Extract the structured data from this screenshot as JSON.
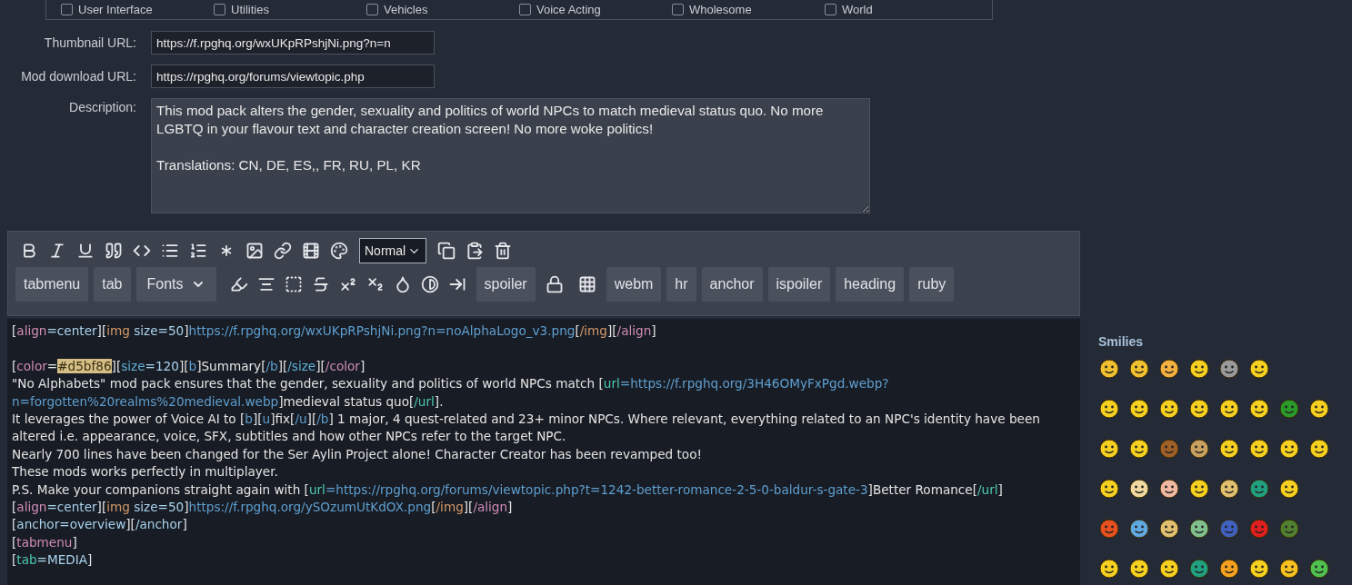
{
  "categories": [
    {
      "label": "User Interface",
      "checked": false
    },
    {
      "label": "Utilities",
      "checked": false
    },
    {
      "label": "Vehicles",
      "checked": false
    },
    {
      "label": "Voice Acting",
      "checked": false
    },
    {
      "label": "Wholesome",
      "checked": false
    },
    {
      "label": "World",
      "checked": false
    }
  ],
  "fields": [
    {
      "label": "Thumbnail URL:",
      "value": "https://f.rpghq.org/wxUKpRPshjNi.png?n=n"
    },
    {
      "label": "Mod download URL:",
      "value": "https://rpghq.org/forums/viewtopic.php"
    }
  ],
  "description": {
    "label": "Description:",
    "value": "This mod pack alters the gender, sexuality and politics of world NPCs to match medieval status quo. No more LGBTQ in your flavour text and character creation screen! No more woke politics!\n\nTranslations: CN, DE, ES,, FR, RU, PL, KR"
  },
  "toolbar": {
    "format_select": "Normal",
    "buttons": [
      {
        "kind": "button",
        "label": "tabmenu"
      },
      {
        "kind": "button",
        "label": "tab"
      },
      {
        "kind": "dropdown",
        "label": "Fonts"
      },
      {
        "kind": "button",
        "label": "spoiler"
      },
      {
        "kind": "button",
        "label": "webm"
      },
      {
        "kind": "button",
        "label": "hr"
      },
      {
        "kind": "button",
        "label": "anchor"
      },
      {
        "kind": "button",
        "label": "ispoiler"
      },
      {
        "kind": "button",
        "label": "heading"
      },
      {
        "kind": "button",
        "label": "ruby"
      }
    ]
  },
  "editor": {
    "lines": [
      [
        {
          "text": "["
        },
        {
          "text": "align",
          "color": "#d18cb8"
        },
        {
          "text": "=center",
          "color": "#a9d2ee"
        },
        {
          "text": "]["
        },
        {
          "text": "img",
          "color": "#d49a6a"
        },
        {
          "text": " size=50",
          "color": "#a9d2ee"
        },
        {
          "text": "]"
        },
        {
          "text": "https://f.rpghq.org/wxUKpRPshjNi.png?n=noAlphaLogo_v3.png",
          "color": "#5f9fd0"
        },
        {
          "text": "["
        },
        {
          "text": "/img",
          "color": "#d49a6a"
        },
        {
          "text": "]["
        },
        {
          "text": "/align",
          "color": "#d18cb8"
        },
        {
          "text": "]"
        }
      ],
      [
        {
          "kind": "blank"
        }
      ],
      [
        {
          "text": "["
        },
        {
          "text": "color",
          "color": "#d18cb8"
        },
        {
          "text": "="
        },
        {
          "text": "#d5bf86",
          "kind": "highlight"
        },
        {
          "text": "]["
        },
        {
          "text": "size",
          "color": "#5fb0d8"
        },
        {
          "text": "=120",
          "color": "#a9d2ee"
        },
        {
          "text": "]["
        },
        {
          "text": "b",
          "color": "#5f9fd0"
        },
        {
          "text": "]Summary["
        },
        {
          "text": "/b",
          "color": "#5f9fd0"
        },
        {
          "text": "]["
        },
        {
          "text": "/size",
          "color": "#5fb0d8"
        },
        {
          "text": "]["
        },
        {
          "text": "/color",
          "color": "#d18cb8"
        },
        {
          "text": "]"
        }
      ],
      [
        {
          "text": "\"No Alphabets\" mod pack ensures that the gender, sexuality and politics of world NPCs match ["
        },
        {
          "text": "url",
          "color": "#4ec9b0"
        },
        {
          "text": "=https://f.rpghq.org/3H46OMyFxPgd.webp?n=forgotten%20realms%20medieval.webp",
          "color": "#5f9fd0"
        },
        {
          "text": "]medieval status quo["
        },
        {
          "text": "/url",
          "color": "#4ec9b0"
        },
        {
          "text": "]."
        }
      ],
      [
        {
          "text": " It leverages the power of Voice AI to ["
        },
        {
          "text": "b",
          "color": "#5f9fd0"
        },
        {
          "text": "]["
        },
        {
          "text": "u",
          "color": "#5f9fd0"
        },
        {
          "text": "]fix["
        },
        {
          "text": "/u",
          "color": "#5f9fd0"
        },
        {
          "text": "]["
        },
        {
          "text": "/b",
          "color": "#5f9fd0"
        },
        {
          "text": "] 1 major, 4 quest-related and 23+ minor NPCs. Where relevant, everything related to an NPC's identity have been altered i.e. appearance, voice, SFX, subtitles and how other NPCs refer to the target NPC."
        }
      ],
      [
        {
          "text": "Nearly 700 lines have been changed for the Ser Aylin Project alone! Character Creator has been revamped too!"
        }
      ],
      [
        {
          "text": "These mods works perfectly in multiplayer."
        }
      ],
      [
        {
          "text": "P.S. Make your companions straight again with ["
        },
        {
          "text": "url",
          "color": "#4ec9b0"
        },
        {
          "text": "=https://rpghq.org/forums/viewtopic.php?t=1242-better-romance-2-5-0-baldur-s-gate-3",
          "color": "#5f9fd0"
        },
        {
          "text": "]Better Romance["
        },
        {
          "text": "/url",
          "color": "#4ec9b0"
        },
        {
          "text": "]"
        }
      ],
      [
        {
          "text": "["
        },
        {
          "text": "align",
          "color": "#d18cb8"
        },
        {
          "text": "=center",
          "color": "#a9d2ee"
        },
        {
          "text": "]["
        },
        {
          "text": "img",
          "color": "#d49a6a"
        },
        {
          "text": " size=50",
          "color": "#a9d2ee"
        },
        {
          "text": "]"
        },
        {
          "text": "https://f.rpghq.org/ySOzumUtKdOX.png",
          "color": "#5f9fd0"
        },
        {
          "text": "["
        },
        {
          "text": "/img",
          "color": "#d49a6a"
        },
        {
          "text": "]["
        },
        {
          "text": "/align",
          "color": "#d18cb8"
        },
        {
          "text": "]"
        }
      ],
      [
        {
          "text": "["
        },
        {
          "text": "anchor=overview",
          "color": "#a9d2ee"
        },
        {
          "text": "]["
        },
        {
          "text": "/anchor",
          "color": "#a9d2ee"
        },
        {
          "text": "]"
        }
      ],
      [
        {
          "text": "["
        },
        {
          "text": "tabmenu",
          "color": "#d18cb8"
        },
        {
          "text": "]"
        }
      ],
      [
        {
          "text": "["
        },
        {
          "text": "tab",
          "color": "#4ec9b0"
        },
        {
          "text": "=MEDIA",
          "color": "#a9d2ee"
        },
        {
          "text": "]"
        }
      ]
    ]
  },
  "smilies": {
    "title": "Smilies"
  }
}
